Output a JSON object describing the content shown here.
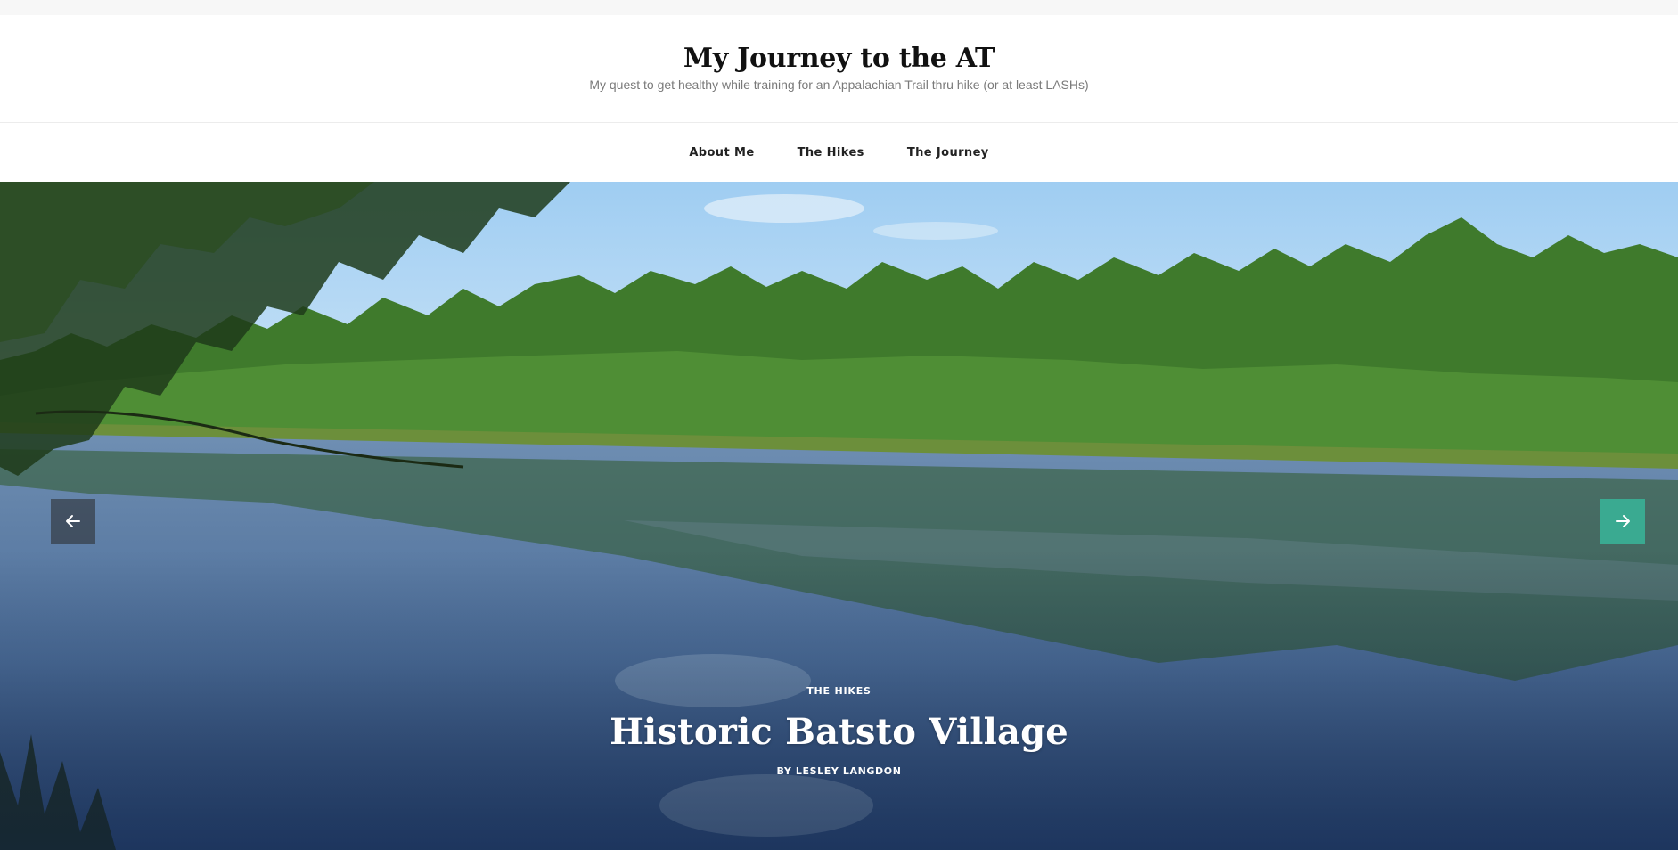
{
  "site": {
    "title": "My Journey to the AT",
    "tagline": "My quest to get healthy while training for an Appalachian Trail thru hike (or at least LASHs)"
  },
  "nav": {
    "items": [
      {
        "label": "About Me"
      },
      {
        "label": "The Hikes"
      },
      {
        "label": "The Journey"
      }
    ]
  },
  "slider": {
    "category": "THE HIKES",
    "title": "Historic Batsto Village",
    "author_prefix": "BY",
    "author": "LESLEY LANGDON",
    "prev_icon": "arrow-left-icon",
    "next_icon": "arrow-right-icon"
  },
  "colors": {
    "accent": "#3aaa91",
    "title": "#111111",
    "tagline": "#7a7a7a"
  }
}
